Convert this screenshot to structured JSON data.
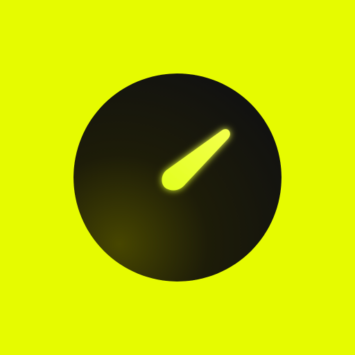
{
  "app": {
    "icon": "speedometer-gauge-icon"
  },
  "colors": {
    "background": "#e6fb00",
    "dial_dark": "#111111",
    "dial_glow": "#474600",
    "needle": "#e2ff1f",
    "needle_glow": "#f3ff4c"
  },
  "gauge": {
    "needle_direction": "upper-right"
  }
}
